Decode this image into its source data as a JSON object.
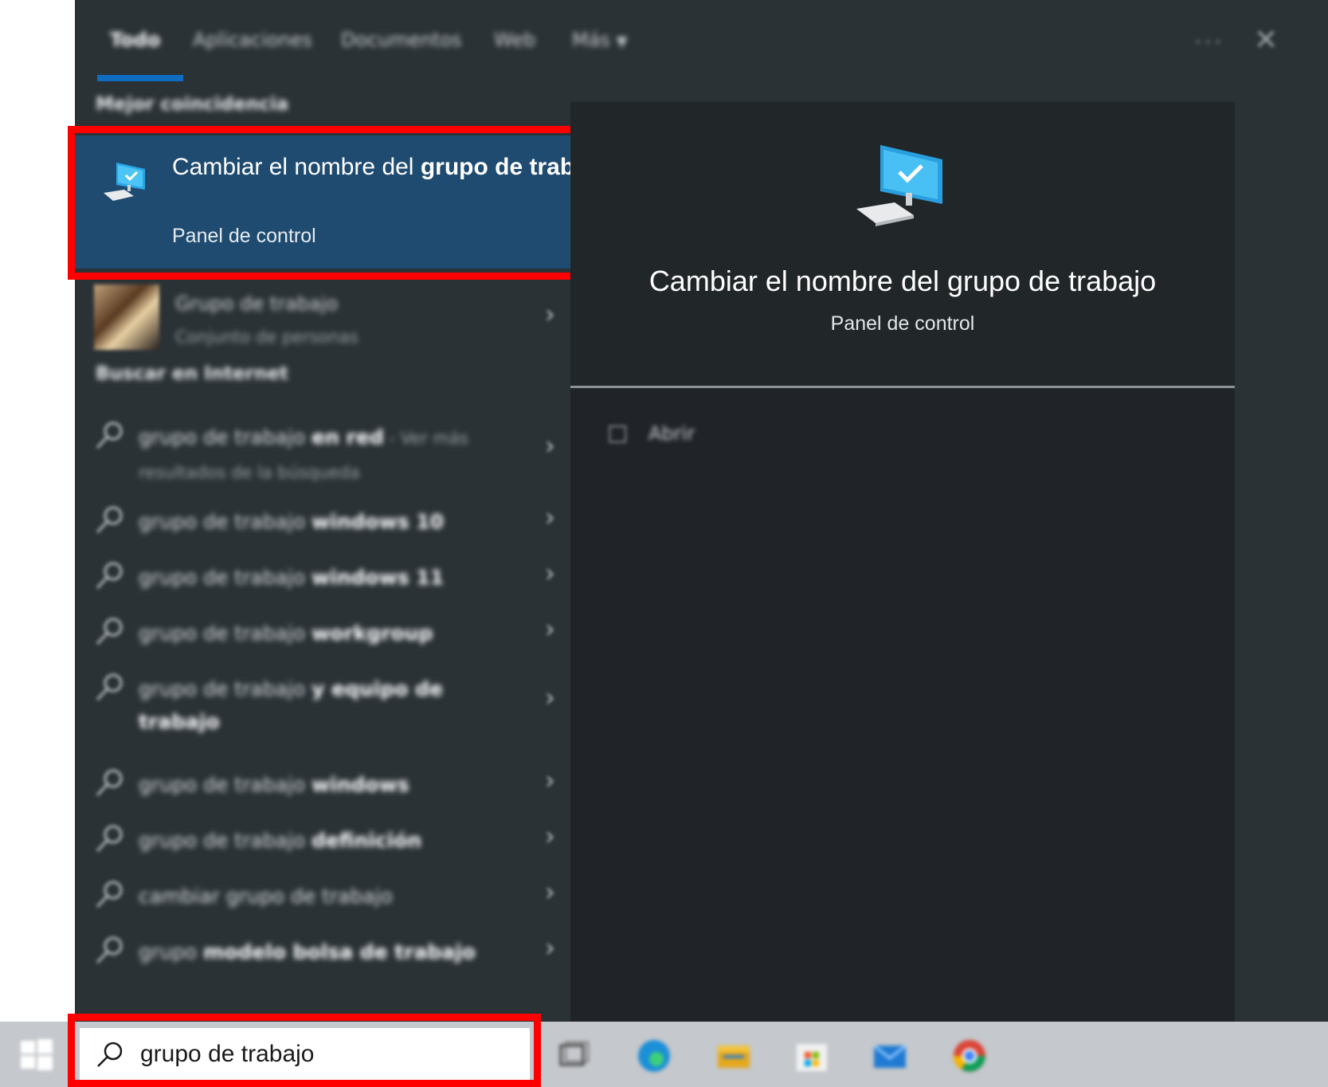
{
  "tabs": [
    {
      "label": "Todo",
      "active": true
    },
    {
      "label": "Aplicaciones",
      "active": false
    },
    {
      "label": "Documentos",
      "active": false
    },
    {
      "label": "Web",
      "active": false
    },
    {
      "label": "Más",
      "active": false
    }
  ],
  "header": {
    "more_options": "···",
    "close_icon": "close-icon"
  },
  "best_match": {
    "section_label": "Mejor coincidencia",
    "title_plain": "Cambiar el nombre del ",
    "title_bold": "grupo de trabajo",
    "subtitle": "Panel de control",
    "icon": "computer-check-icon"
  },
  "contacts": {
    "title": "Grupo de trabajo",
    "subtitle": "Conjunto de personas"
  },
  "web": {
    "section_label": "Buscar en Internet",
    "results": [
      {
        "plain": "grupo de trabajo ",
        "bold": "en red",
        "hint": " - Ver más resultados de la búsqueda"
      },
      {
        "plain": "grupo de trabajo ",
        "bold": "windows 10",
        "hint": ""
      },
      {
        "plain": "grupo de trabajo ",
        "bold": "windows 11",
        "hint": ""
      },
      {
        "plain": "grupo de trabajo ",
        "bold": "workgroup",
        "hint": ""
      },
      {
        "plain": "grupo de trabajo ",
        "bold": "y equipo de trabajo",
        "hint": ""
      },
      {
        "plain": "grupo de trabajo ",
        "bold": "windows",
        "hint": ""
      },
      {
        "plain": "grupo de trabajo ",
        "bold": "definición",
        "hint": ""
      },
      {
        "plain": "cambiar grupo de trabajo",
        "bold": "",
        "hint": ""
      },
      {
        "plain": "grupo ",
        "bold": "modelo bolsa de trabajo",
        "hint": ""
      }
    ]
  },
  "preview": {
    "title": "Cambiar el nombre del grupo de trabajo",
    "subtitle": "Panel de control",
    "open_label": "Abrir"
  },
  "taskbar": {
    "search_value": "grupo de trabajo",
    "apps": [
      "task-view-icon",
      "edge-icon",
      "file-explorer-icon",
      "store-icon",
      "mail-icon",
      "chrome-icon"
    ]
  },
  "colors": {
    "panel_bg": "#2b3236",
    "selected_bg": "#1f4b70",
    "accent": "#0f6cc0",
    "highlight_box": "#ff0000",
    "taskbar_bg": "#c5c8cc"
  }
}
